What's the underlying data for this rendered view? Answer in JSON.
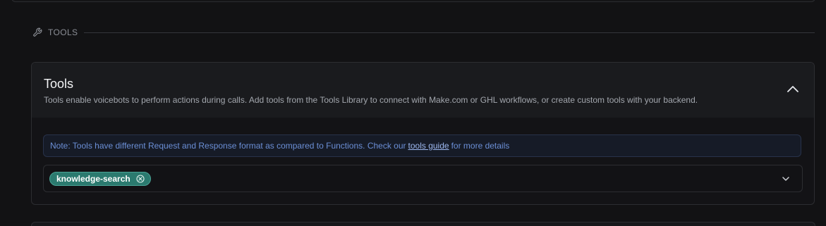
{
  "section": {
    "label": "TOOLS",
    "icon": "wrench-icon"
  },
  "card": {
    "title": "Tools",
    "description": "Tools enable voicebots to perform actions during calls. Add tools from the Tools Library to connect with Make.com or GHL workflows, or create custom tools with your backend.",
    "collapse_icon": "chevron-up-icon"
  },
  "note": {
    "prefix": "Note: Tools have different Request and Response format as compared to Functions. Check our",
    "link_text": "tools guide",
    "suffix": "for more details"
  },
  "tools_select": {
    "selected": [
      {
        "label": "knowledge-search",
        "remove_icon": "close-circle-icon"
      }
    ],
    "dropdown_icon": "chevron-down-icon"
  },
  "colors": {
    "background": "#121214",
    "chip": "#2b7a6f",
    "note_text": "#6b8fd6"
  }
}
